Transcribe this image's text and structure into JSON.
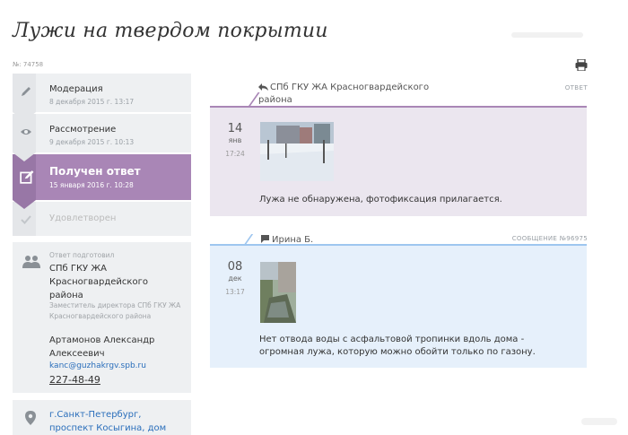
{
  "page": {
    "title": "Лужи на твердом покрытии",
    "id_label": "№: 74758"
  },
  "status": {
    "steps": [
      {
        "label": "Модерация",
        "date": "8 декабря 2015 г. 13:17",
        "icon": "pencil-icon"
      },
      {
        "label": "Рассмотрение",
        "date": "9 декабря 2015 г. 10:13",
        "icon": "eye-icon"
      },
      {
        "label": "Получен ответ",
        "date": "15 января 2016 г. 10:28",
        "icon": "edit-square-icon"
      },
      {
        "label": "Удовлетворен",
        "date": "",
        "icon": "check-icon"
      }
    ],
    "active_color": "#a986b6"
  },
  "responder": {
    "prepared_label": "Ответ подготовил",
    "organization": "СПб ГКУ ЖА Красногвардейского района",
    "position": "Заместитель директора СПб ГКУ ЖА Красногвардейского района",
    "name": "Артамонов Александр Алексеевич",
    "email": "kanc@guzhakrgv.spb.ru",
    "phone": "227-48-49"
  },
  "address": {
    "text": "г.Санкт-Петербург, проспект Косыгина, дом"
  },
  "feed": {
    "reply": {
      "type_label": "ОТВЕТ",
      "author": "СПб ГКУ ЖА Красногвардейского района",
      "day": "14",
      "month": "янв",
      "time": "17:24",
      "text": "Лужа не обнаружена, фотофиксация прилагается."
    },
    "user_message": {
      "number_label": "СООБЩЕНИЕ №96975",
      "author": "Ирина Б.",
      "day": "08",
      "month": "дек",
      "time": "13:17",
      "text": "Нет отвода воды с асфальтовой тропинки вдоль дома - огромная лужа, которую можно обойти только по газону."
    }
  }
}
